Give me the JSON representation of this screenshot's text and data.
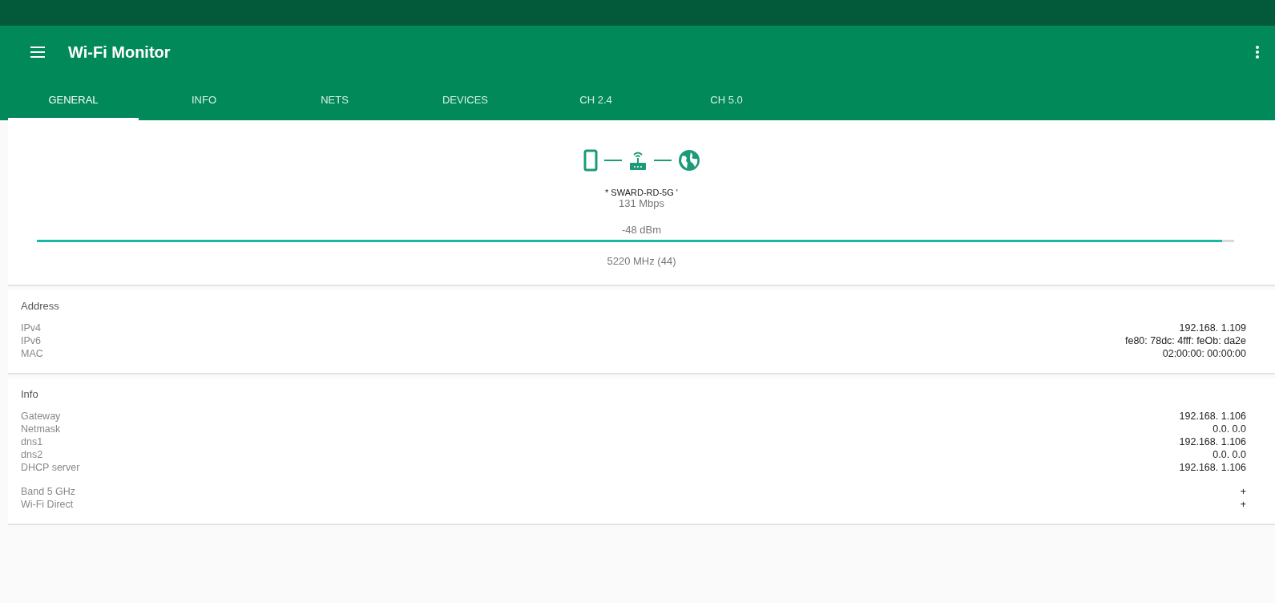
{
  "app_bar": {
    "title": "Wi-Fi Monitor"
  },
  "tabs": [
    {
      "label": "GENERAL",
      "selected": true
    },
    {
      "label": "INFO",
      "selected": false
    },
    {
      "label": "NETS",
      "selected": false
    },
    {
      "label": "DEVICES",
      "selected": false
    },
    {
      "label": "CH 2.4",
      "selected": false
    },
    {
      "label": "CH 5.0",
      "selected": false
    }
  ],
  "connection": {
    "ssid": "* SWARD-RD-5G '",
    "speed": "131 Mbps",
    "signal": {
      "reading": "-48 dBm",
      "level": 0.99
    },
    "frequency": "5220 MHz (44)"
  },
  "sections": [
    {
      "title": "Address",
      "groups": [
        [
          {
            "label": "IPv4",
            "value": "192.168. 1.109"
          },
          {
            "label": "IPv6",
            "value": "fe80: 78dc: 4fff: feOb: da2e"
          },
          {
            "label": "MAC",
            "value": "02:00:00: 00:00:00"
          }
        ]
      ]
    },
    {
      "title": "Info",
      "groups": [
        [
          {
            "label": "Gateway",
            "value": "192.168. 1.106"
          },
          {
            "label": "Netmask",
            "value": "0.0. 0.0"
          },
          {
            "label": "dns1",
            "value": "192.168. 1.106"
          },
          {
            "label": "dns2",
            "value": "0.0. 0.0"
          },
          {
            "label": "DHCP server",
            "value": "192.168. 1.106"
          }
        ],
        [
          {
            "label": "Band 5 GHz",
            "value": "+"
          },
          {
            "label": "Wi-Fi Direct",
            "value": "+"
          }
        ]
      ]
    }
  ]
}
